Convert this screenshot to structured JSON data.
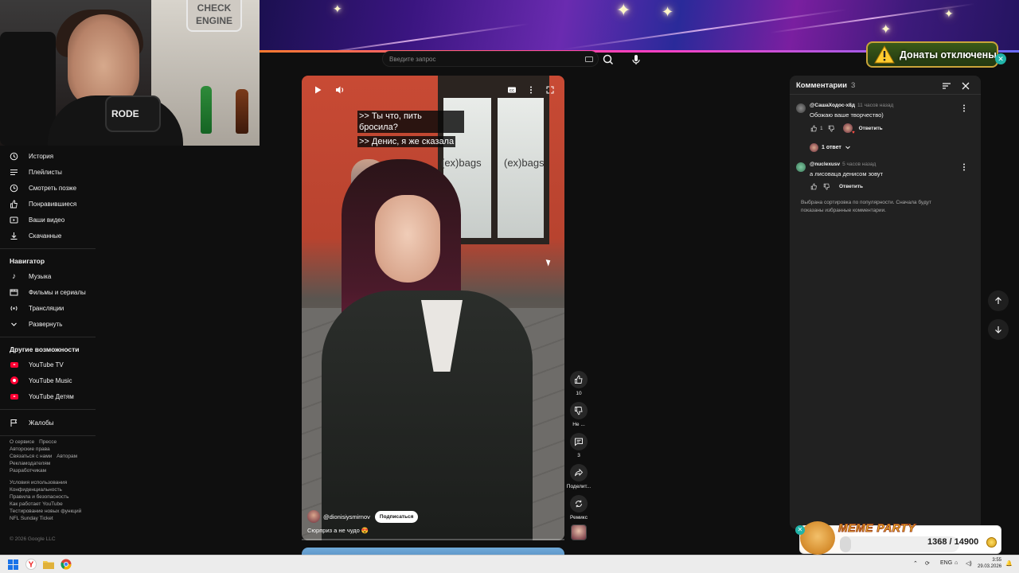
{
  "search": {
    "placeholder": "Введите запрос"
  },
  "webcam": {
    "sign_text": "CHECK ENGINE",
    "mic_brand": "RODE"
  },
  "sidebar": {
    "you_items": [
      {
        "label": "История",
        "icon": "history-icon"
      },
      {
        "label": "Плейлисты",
        "icon": "playlist-icon"
      },
      {
        "label": "Смотреть позже",
        "icon": "watch-later-icon"
      },
      {
        "label": "Понравившиеся",
        "icon": "like-icon"
      },
      {
        "label": "Ваши видео",
        "icon": "your-videos-icon"
      },
      {
        "label": "Скачанные",
        "icon": "download-icon"
      }
    ],
    "navigator_title": "Навигатор",
    "navigator_items": [
      {
        "label": "Музыка",
        "icon": "music-icon"
      },
      {
        "label": "Фильмы и сериалы",
        "icon": "movies-icon"
      },
      {
        "label": "Трансляции",
        "icon": "live-icon"
      },
      {
        "label": "Развернуть",
        "icon": "chevron-down-icon"
      }
    ],
    "other_title": "Другие возможности",
    "other_items": [
      {
        "label": "YouTube TV",
        "icon": "youtube-tv-icon"
      },
      {
        "label": "YouTube Music",
        "icon": "youtube-music-icon"
      },
      {
        "label": "YouTube Детям",
        "icon": "youtube-kids-icon"
      }
    ],
    "report_label": "Жалобы",
    "footer_1": [
      "О сервисе",
      "Прессе",
      "Авторские права",
      "Связаться с нами",
      "Авторам",
      "Рекламодателям",
      "Разработчикам"
    ],
    "footer_2": [
      "Условия использования",
      "Конфиденциальность",
      "Правила и безопасность",
      "Как работает YouTube",
      "Тестирование новых функций",
      "NFL Sunday Ticket"
    ],
    "copyright": "© 2026 Google LLC"
  },
  "video": {
    "subtitle_line1": ">> Ты что, пить бросила?",
    "subtitle_line2": ">> Денис, я же сказала",
    "shop_sign_1": "(ex)bags",
    "shop_sign_2": "(ex)bags",
    "channel": "@dionisiysmirnov",
    "subscribe_label": "Подписаться",
    "caption": "Сюрприз а не чудо 😍",
    "progress_percent": 0
  },
  "actions": {
    "like_count": "10",
    "dislike_label": "Не ...",
    "comments_count": "3",
    "share_label": "Поделит...",
    "remix_label": "Ремикс"
  },
  "comments": {
    "title": "Комментарии",
    "count": "3",
    "items": [
      {
        "author": "@СашаХодос-х8д",
        "time": "11 часов назад",
        "text": "Обожаю ваше творчество)",
        "likes": "1",
        "reply_label": "Ответить",
        "replies_label": "1 ответ"
      },
      {
        "author": "@nuclexusv",
        "time": "5 часов назад",
        "text": "а лисоваца денисом зовут",
        "likes": "",
        "reply_label": "Ответить"
      }
    ],
    "sort_note": "Выбрана сортировка по популярности. Сначала будут показаны избранные комментарии."
  },
  "overlays": {
    "donate_text": "Донаты отключены",
    "meme_title": "MEME PARTY",
    "meme_current": 1368,
    "meme_goal": 14900,
    "meme_count_text": "1368 / 14900"
  },
  "taskbar": {
    "lang": "ENG",
    "time": "3:55",
    "date": "29.03.2026"
  },
  "colors": {
    "accent_red": "#ff0033",
    "panel_bg": "#212121",
    "page_bg": "#0f0f0f"
  }
}
